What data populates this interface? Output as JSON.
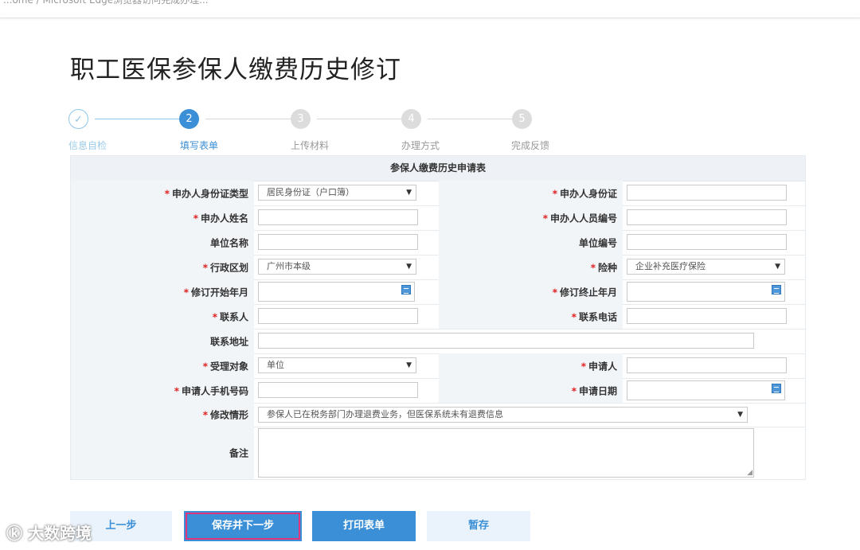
{
  "topbar": {
    "text": "...ome / Microsoft Edge浏览器访问完成办理..."
  },
  "page": {
    "title": "职工医保参保人缴费历史修订"
  },
  "steps": [
    {
      "number": "✓",
      "label": "信息自检",
      "state": "done"
    },
    {
      "number": "2",
      "label": "填写表单",
      "state": "active"
    },
    {
      "number": "3",
      "label": "上传材料",
      "state": "todo"
    },
    {
      "number": "4",
      "label": "办理方式",
      "state": "todo"
    },
    {
      "number": "5",
      "label": "完成反馈",
      "state": "todo"
    }
  ],
  "form": {
    "title": "参保人缴费历史申请表",
    "required_mark": "*",
    "fields": {
      "id_type": {
        "label": "申办人身份证类型",
        "value": "居民身份证（户口簿）"
      },
      "id_number": {
        "label": "申办人身份证",
        "value": ""
      },
      "name": {
        "label": "申办人姓名",
        "value": ""
      },
      "person_no": {
        "label": "申办人人员编号",
        "value": ""
      },
      "unit_name": {
        "label": "单位名称",
        "value": ""
      },
      "unit_no": {
        "label": "单位编号",
        "value": ""
      },
      "region": {
        "label": "行政区划",
        "value": "广州市本级"
      },
      "insurance_type": {
        "label": "险种",
        "value": "企业补充医疗保险"
      },
      "start_month": {
        "label": "修订开始年月",
        "value": ""
      },
      "end_month": {
        "label": "修订终止年月",
        "value": ""
      },
      "contact": {
        "label": "联系人",
        "value": ""
      },
      "contact_phone": {
        "label": "联系电话",
        "value": ""
      },
      "address": {
        "label": "联系地址",
        "value": ""
      },
      "target": {
        "label": "受理对象",
        "value": "单位"
      },
      "applicant": {
        "label": "申请人",
        "value": ""
      },
      "applicant_mobile": {
        "label": "申请人手机号码",
        "value": ""
      },
      "apply_date": {
        "label": "申请日期",
        "value": ""
      },
      "situation": {
        "label": "修改情形",
        "value": "参保人已在税务部门办理退费业务，但医保系统未有退费信息"
      },
      "remark": {
        "label": "备注",
        "value": ""
      }
    }
  },
  "buttons": {
    "prev": "上一步",
    "save_next": "保存并下一步",
    "print": "打印表单",
    "temp_save": "暂存"
  },
  "colors": {
    "accent": "#3a8fd6",
    "required": "#e02020",
    "highlight": "#e0347c"
  },
  "watermark": {
    "text": "大数跨境"
  }
}
